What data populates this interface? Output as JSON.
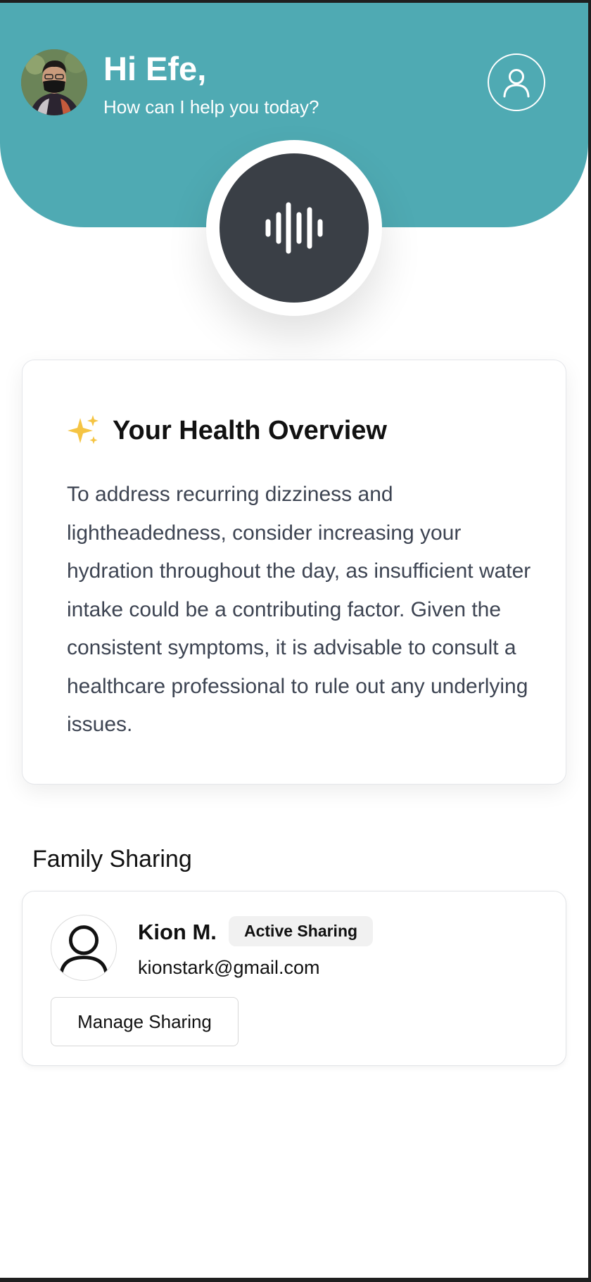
{
  "header": {
    "greeting": "Hi Efe,",
    "subtitle": "How can I help you today?",
    "background_color": "#4faab3"
  },
  "icons": {
    "profile": "user-outline-icon",
    "voice": "sound-wave-icon",
    "sparkle": "sparkles-emoji"
  },
  "overview": {
    "title": "Your Health Overview",
    "body": "To address recurring dizziness and lightheadedness, consider increasing your hydration throughout the day, as insufficient water intake could be a contributing factor. Given the consistent symptoms, it is advisable to consult a healthcare professional to rule out any underlying issues."
  },
  "family_sharing": {
    "section_title": "Family Sharing",
    "member": {
      "name": "Kion M.",
      "status": "Active Sharing",
      "email": "kionstark@gmail.com"
    },
    "manage_label": "Manage Sharing"
  },
  "colors": {
    "accent": "#4faab3",
    "voice_button": "#3a3f46"
  }
}
